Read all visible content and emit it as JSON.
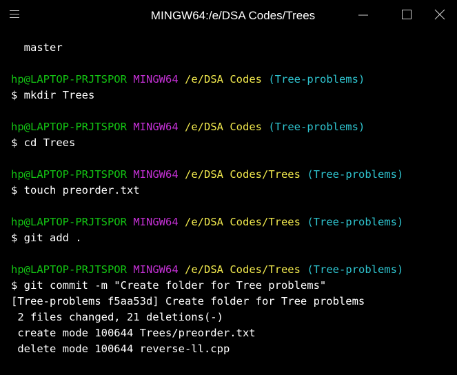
{
  "window": {
    "title": "MINGW64:/e/DSA Codes/Trees",
    "menu_icon": "hamburger-icon",
    "minimize_icon": "minimize-icon",
    "maximize_icon": "maximize-icon",
    "close_icon": "close-icon"
  },
  "colors": {
    "user_host": "#13c413",
    "env": "#c531d6",
    "path": "#f0e84d",
    "branch": "#2fc5d0",
    "text": "#ffffff",
    "background": "#000000"
  },
  "terminal": {
    "lines": [
      {
        "text": "  master"
      },
      {
        "text": ""
      },
      {
        "prompt": {
          "user": "hp@LAPTOP-PRJTSPOR",
          "env": "MINGW64",
          "path": "/e/DSA Codes",
          "branch": "(Tree-problems)"
        }
      },
      {
        "text": "$ mkdir Trees"
      },
      {
        "text": ""
      },
      {
        "prompt": {
          "user": "hp@LAPTOP-PRJTSPOR",
          "env": "MINGW64",
          "path": "/e/DSA Codes",
          "branch": "(Tree-problems)"
        }
      },
      {
        "text": "$ cd Trees"
      },
      {
        "text": ""
      },
      {
        "prompt": {
          "user": "hp@LAPTOP-PRJTSPOR",
          "env": "MINGW64",
          "path": "/e/DSA Codes/Trees",
          "branch": "(Tree-problems)"
        }
      },
      {
        "text": "$ touch preorder.txt"
      },
      {
        "text": ""
      },
      {
        "prompt": {
          "user": "hp@LAPTOP-PRJTSPOR",
          "env": "MINGW64",
          "path": "/e/DSA Codes/Trees",
          "branch": "(Tree-problems)"
        }
      },
      {
        "text": "$ git add ."
      },
      {
        "text": ""
      },
      {
        "prompt": {
          "user": "hp@LAPTOP-PRJTSPOR",
          "env": "MINGW64",
          "path": "/e/DSA Codes/Trees",
          "branch": "(Tree-problems)"
        }
      },
      {
        "text": "$ git commit -m \"Create folder for Tree problems\""
      },
      {
        "text": "[Tree-problems f5aa53d] Create folder for Tree problems"
      },
      {
        "text": " 2 files changed, 21 deletions(-)"
      },
      {
        "text": " create mode 100644 Trees/preorder.txt"
      },
      {
        "text": " delete mode 100644 reverse-ll.cpp"
      }
    ]
  }
}
